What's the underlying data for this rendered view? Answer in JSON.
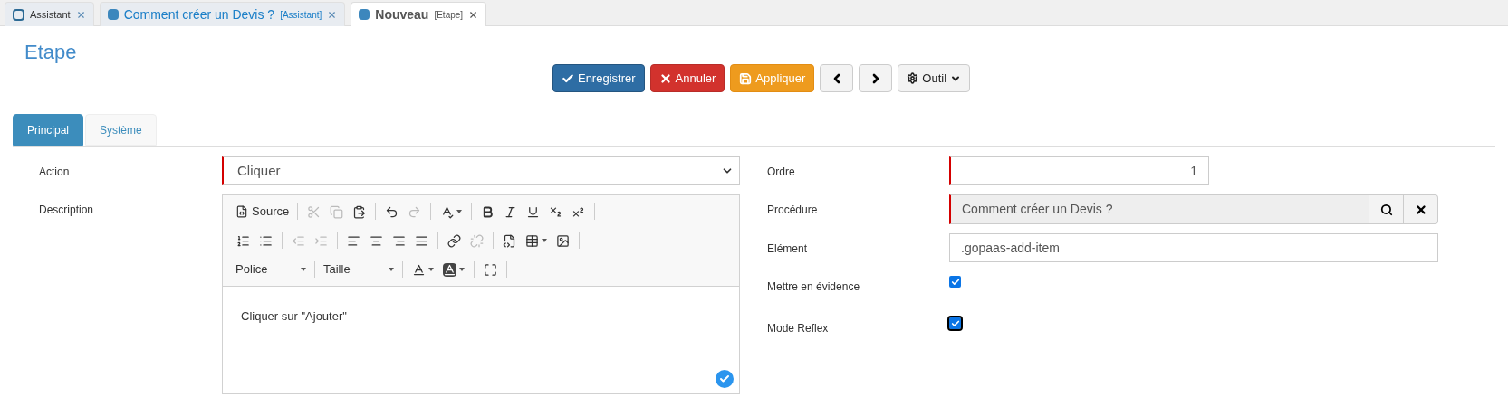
{
  "doc_tabs": [
    {
      "label": "Assistant",
      "selected": false,
      "kind": "outline"
    },
    {
      "label": "Comment créer un Devis ?",
      "suffix": "[Assistant]",
      "selected": false,
      "kind": "solid"
    },
    {
      "label": "Nouveau",
      "suffix": "[Etape]",
      "selected": true,
      "kind": "solid"
    }
  ],
  "page_title": "Etape",
  "toolbar_buttons": [
    {
      "label": "Enregistrer",
      "kind": "primary"
    },
    {
      "label": "Annuler",
      "kind": "danger"
    },
    {
      "label": "Appliquer",
      "kind": "warning"
    },
    {
      "kind": "prev"
    },
    {
      "kind": "next"
    },
    {
      "label": "Outil",
      "kind": "tools"
    }
  ],
  "form_tabs": [
    {
      "label": "Principal",
      "selected": true
    },
    {
      "label": "Système",
      "selected": false
    }
  ],
  "left_fields": [
    {
      "label": "Action",
      "kind": "select",
      "value": "Cliquer",
      "required": true
    },
    {
      "label": "Description",
      "kind": "editor",
      "value": "Cliquer sur \"Ajouter\""
    }
  ],
  "editor_toolbar": [
    [
      {
        "kind": "source",
        "label": "Source",
        "disabled": false
      },
      {
        "kind": "sep"
      },
      {
        "kind": "cut",
        "disabled": true
      },
      {
        "kind": "copy",
        "disabled": true
      },
      {
        "kind": "paste",
        "disabled": false
      },
      {
        "kind": "sep"
      },
      {
        "kind": "undo",
        "disabled": false
      },
      {
        "kind": "redo",
        "disabled": true
      },
      {
        "kind": "sep"
      },
      {
        "kind": "spellcheck",
        "disabled": false
      },
      {
        "kind": "sep"
      },
      {
        "kind": "bold",
        "disabled": false
      },
      {
        "kind": "italic",
        "disabled": false
      },
      {
        "kind": "underline",
        "disabled": false
      },
      {
        "kind": "subscript",
        "disabled": false
      },
      {
        "kind": "superscript",
        "disabled": false
      },
      {
        "kind": "sep"
      }
    ],
    [
      {
        "kind": "ordered",
        "disabled": false
      },
      {
        "kind": "bullets",
        "disabled": false
      },
      {
        "kind": "sep"
      },
      {
        "kind": "outdent",
        "disabled": true
      },
      {
        "kind": "indent",
        "disabled": true
      },
      {
        "kind": "sep"
      },
      {
        "kind": "left",
        "disabled": false
      },
      {
        "kind": "center",
        "disabled": false
      },
      {
        "kind": "right",
        "disabled": false
      },
      {
        "kind": "justify",
        "disabled": false
      },
      {
        "kind": "sep"
      },
      {
        "kind": "link",
        "disabled": false
      },
      {
        "kind": "unlink",
        "disabled": true
      },
      {
        "kind": "sep"
      },
      {
        "kind": "template",
        "disabled": false
      },
      {
        "kind": "table",
        "disabled": false
      },
      {
        "kind": "image",
        "disabled": false
      },
      {
        "kind": "sep"
      }
    ],
    [
      {
        "kind": "combo",
        "label": "Police",
        "disabled": false
      },
      {
        "kind": "sep"
      },
      {
        "kind": "combo",
        "label": "Taille",
        "disabled": false
      },
      {
        "kind": "sep"
      },
      {
        "kind": "textcolor",
        "disabled": false
      },
      {
        "kind": "bgcolor",
        "disabled": false
      },
      {
        "kind": "sep"
      },
      {
        "kind": "maximize",
        "disabled": false
      },
      {
        "kind": "sep"
      }
    ]
  ],
  "right_fields": [
    {
      "label": "Ordre",
      "kind": "number",
      "value": "1",
      "required": true
    },
    {
      "label": "Procédure",
      "kind": "lookup",
      "value": "Comment créer un Devis ?",
      "required": true
    },
    {
      "label": "Elément",
      "kind": "text",
      "value": ".gopaas-add-item",
      "required": false
    },
    {
      "label": "Mettre en évidence",
      "kind": "checkbox",
      "checked": true,
      "focused": false
    },
    {
      "label": "Mode Reflex",
      "kind": "checkbox",
      "checked": true,
      "focused": true
    }
  ]
}
